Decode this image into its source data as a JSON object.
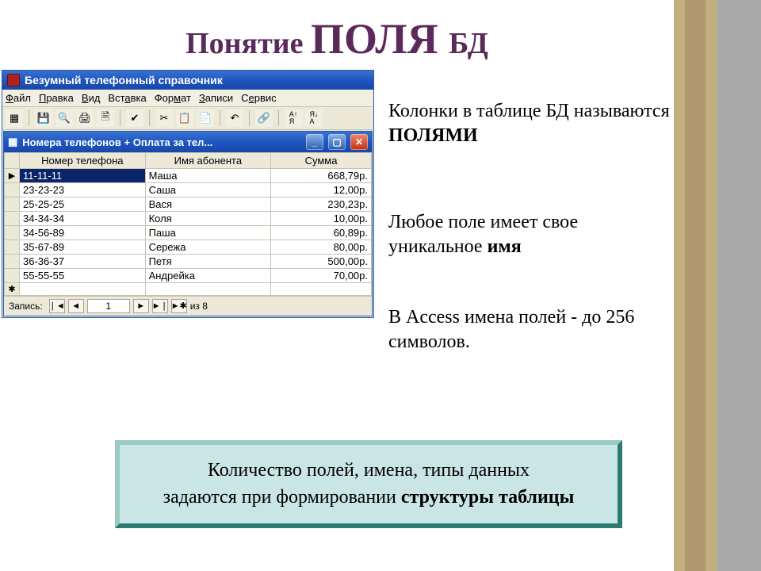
{
  "slide": {
    "title_1": "Понятие ",
    "title_big": "ПОЛЯ ",
    "title_2": "БД"
  },
  "window": {
    "app_title": "Безумный телефонный справочник",
    "sub_title": "Номера телефонов + Оплата за тел...",
    "menu": {
      "file": "Файл",
      "edit": "Правка",
      "view": "Вид",
      "insert": "Вставка",
      "format": "Формат",
      "records": "Записи",
      "service": "Сервис"
    },
    "columns": {
      "phone": "Номер телефона",
      "name": "Имя абонента",
      "sum": "Сумма"
    },
    "rows": [
      {
        "phone": "11-11-11",
        "name": "Маша",
        "sum": "668,79р."
      },
      {
        "phone": "23-23-23",
        "name": "Саша",
        "sum": "12,00р."
      },
      {
        "phone": "25-25-25",
        "name": "Вася",
        "sum": "230,23р."
      },
      {
        "phone": "34-34-34",
        "name": "Коля",
        "sum": "10,00р."
      },
      {
        "phone": "34-56-89",
        "name": "Паша",
        "sum": "60,89р."
      },
      {
        "phone": "35-67-89",
        "name": "Сережа",
        "sum": "80,00р."
      },
      {
        "phone": "36-36-37",
        "name": "Петя",
        "sum": "500,00р."
      },
      {
        "phone": "55-55-55",
        "name": "Андрейка",
        "sum": "70,00р."
      }
    ],
    "recnav": {
      "label": "Запись:",
      "value": "1",
      "of_label": "из 8"
    }
  },
  "explain": {
    "block1_a": "Колонки в таблице БД называются ",
    "block1_b": "ПОЛЯМИ",
    "block2_a": "Любое поле имеет свое уникальное ",
    "block2_b": "имя",
    "block3": "В Access имена полей - до 256 символов."
  },
  "bottom": {
    "line1": "Количество полей, имена, типы данных",
    "line2_a": "задаются при формировании ",
    "line2_b": "структуры таблицы"
  }
}
